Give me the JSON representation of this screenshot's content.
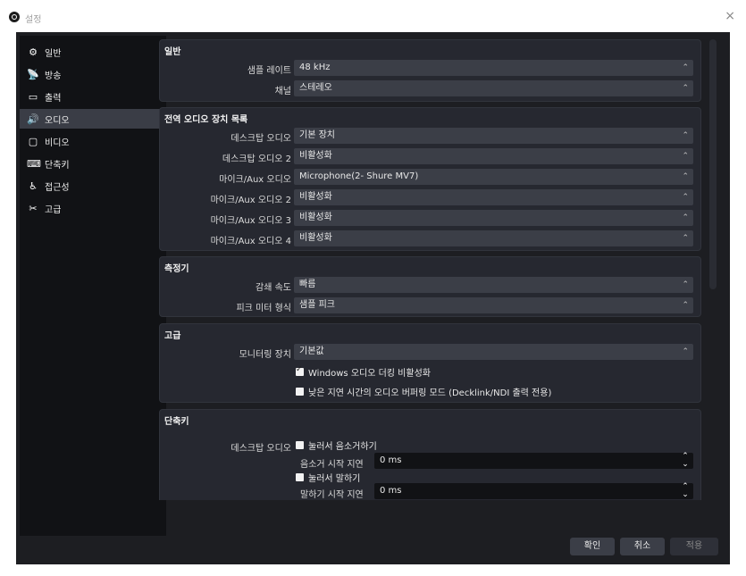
{
  "window": {
    "title": "설정",
    "close": "×"
  },
  "sidebar": {
    "items": [
      {
        "label": "일반",
        "icon": "gear-icon",
        "glyph": "⚙"
      },
      {
        "label": "방송",
        "icon": "broadcast-icon",
        "glyph": "📡"
      },
      {
        "label": "출력",
        "icon": "output-icon",
        "glyph": "▭"
      },
      {
        "label": "오디오",
        "icon": "speaker-icon",
        "glyph": "🔊"
      },
      {
        "label": "비디오",
        "icon": "monitor-icon",
        "glyph": "▢"
      },
      {
        "label": "단축키",
        "icon": "keyboard-icon",
        "glyph": "⌨"
      },
      {
        "label": "접근성",
        "icon": "accessibility-icon",
        "glyph": "♿"
      },
      {
        "label": "고급",
        "icon": "tools-icon",
        "glyph": "✂"
      }
    ],
    "active_index": 3
  },
  "general": {
    "title": "일반",
    "sample_rate_label": "샘플 레이트",
    "sample_rate_value": "48 kHz",
    "channel_label": "채널",
    "channel_value": "스테레오"
  },
  "global_devices": {
    "title": "전역 오디오 장치 목록",
    "rows": [
      {
        "label": "데스크탑 오디오",
        "value": "기본 장치"
      },
      {
        "label": "데스크탑 오디오 2",
        "value": "비활성화"
      },
      {
        "label": "마이크/Aux 오디오",
        "value": "Microphone(2- Shure MV7)"
      },
      {
        "label": "마이크/Aux 오디오 2",
        "value": "비활성화"
      },
      {
        "label": "마이크/Aux 오디오 3",
        "value": "비활성화"
      },
      {
        "label": "마이크/Aux 오디오 4",
        "value": "비활성화"
      }
    ]
  },
  "meters": {
    "title": "측정기",
    "decay_label": "감쇄 속도",
    "decay_value": "빠름",
    "peak_label": "피크 미터 형식",
    "peak_value": "샘플 피크"
  },
  "advanced": {
    "title": "고급",
    "monitoring_label": "모니터링 장치",
    "monitoring_value": "기본값",
    "ducking_label": "Windows 오디오 더킹 비활성화",
    "ducking_checked": true,
    "lowlatency_label": "낮은 지연 시간의 오디오 버퍼링 모드 (Decklink/NDI 출력 전용)",
    "lowlatency_checked": false
  },
  "hotkeys": {
    "title": "단축키",
    "desktop_label": "데스크탑 오디오",
    "push_to_mute_label": "눌러서 음소거하기",
    "mute_delay_label": "음소거 시작 지연",
    "mute_delay_value": "0 ms",
    "push_to_talk_label": "눌러서 말하기",
    "talk_delay_label": "말하기 시작 지연",
    "talk_delay_value": "0 ms"
  },
  "footer": {
    "ok": "확인",
    "cancel": "취소",
    "apply": "적용"
  },
  "chevron": "⌃⌄"
}
